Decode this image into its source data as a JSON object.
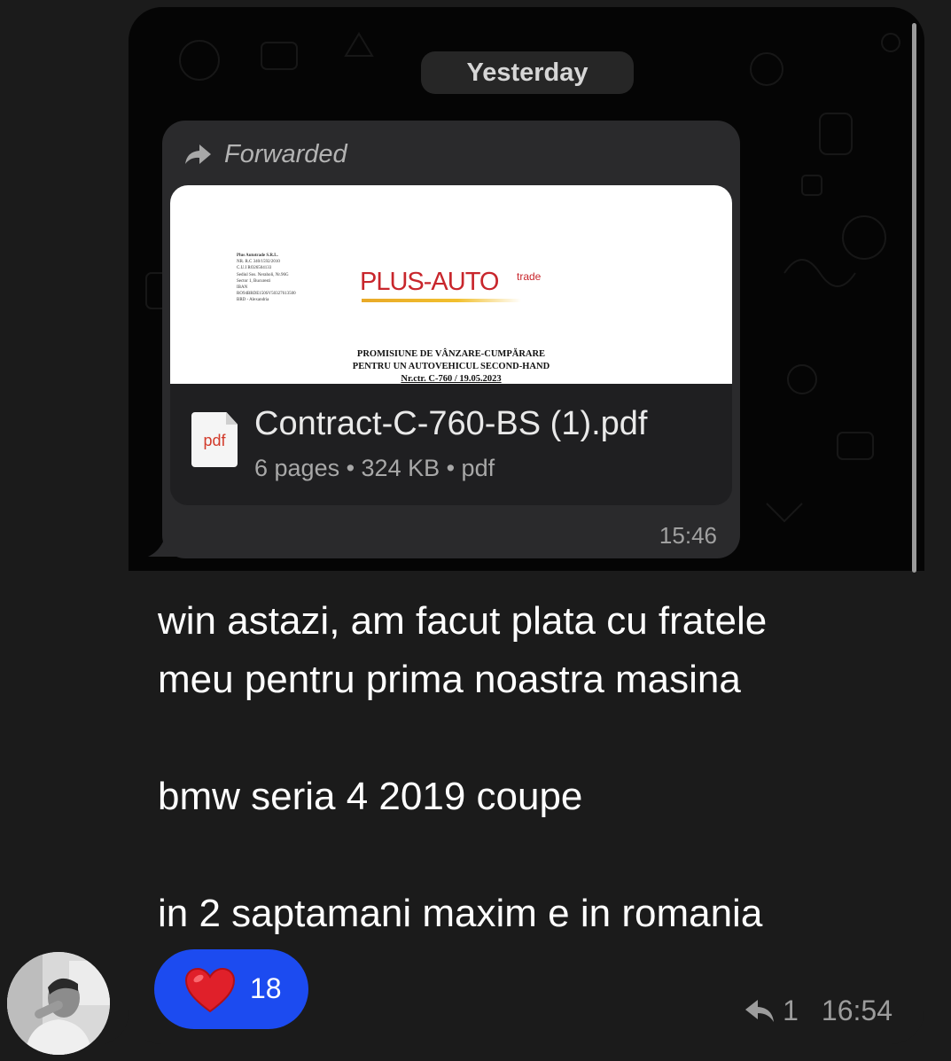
{
  "date_separator": "Yesterday",
  "forwarded": {
    "label": "Forwarded",
    "document": {
      "company_info": [
        "Plus Autotrade S.R.L.",
        "NR. R.C 340/1592/2010",
        "C.U.I RO26504133",
        "Sediul Sos. Neraholi, Nr.96G",
        "Sector 1, Bucuresti",
        "IBAN",
        "RO94BRDE150SV50327613500",
        "BRD - Alexandria"
      ],
      "logo_text": "PLUS-AUTO",
      "logo_sup": "trade",
      "heading_line1": "PROMISIUNE DE VÂNZARE-CUMPĂRARE",
      "heading_line2": "PENTRU UN AUTOVEHICUL SECOND-HAND",
      "heading_line3": "Nr.ctr. C-760 / 19.05.2023",
      "file_icon_label": "pdf",
      "file_name": "Contract-C-760-BS (1).pdf",
      "file_meta": "6 pages • 324 KB • pdf"
    },
    "time": "15:46"
  },
  "message": {
    "text": "win astazi, am facut plata cu fratele\nmeu pentru prima noastra masina\n\nbmw seria 4 2019 coupe\n\nin 2 saptamani maxim e in romania",
    "reaction": {
      "emoji": "heart-icon",
      "count": "18",
      "color": "#1c4bf0"
    },
    "replies": "1",
    "time": "16:54"
  },
  "colors": {
    "background": "#1b1b1b",
    "bubble": "#2a2a2c",
    "reaction_pill": "#1c4bf0",
    "heart": "#e0202a"
  }
}
